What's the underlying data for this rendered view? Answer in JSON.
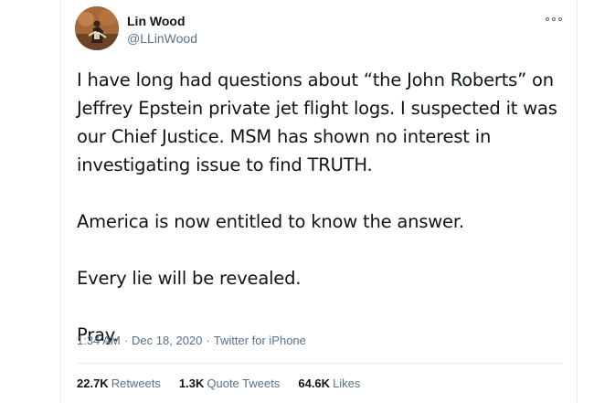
{
  "author": {
    "display_name": "Lin Wood",
    "handle": "@LLinWood",
    "avatar_icon": "profile-photo-avatar"
  },
  "menu_icon": "more-dots-icon",
  "tweet": {
    "paragraphs": [
      "I have long had questions about “the John Roberts” on Jeffrey Epstein private jet flight logs.  I suspected it was our Chief Justice. MSM has shown no interest in investigating issue to find TRUTH.",
      "America is now entitled to know the answer.",
      "Every lie will be revealed.",
      "Pray."
    ]
  },
  "meta": {
    "time": "1:34 AM",
    "separator": "·",
    "date": "Dec 18, 2020",
    "source": "Twitter for iPhone"
  },
  "stats": {
    "retweets_count": "22.7K",
    "retweets_label": "Retweets",
    "quotes_count": "1.3K",
    "quotes_label": "Quote Tweets",
    "likes_count": "64.6K",
    "likes_label": "Likes"
  },
  "colors": {
    "text_primary": "#0f1419",
    "text_secondary": "#5b7083",
    "border": "#e6ecf0"
  }
}
